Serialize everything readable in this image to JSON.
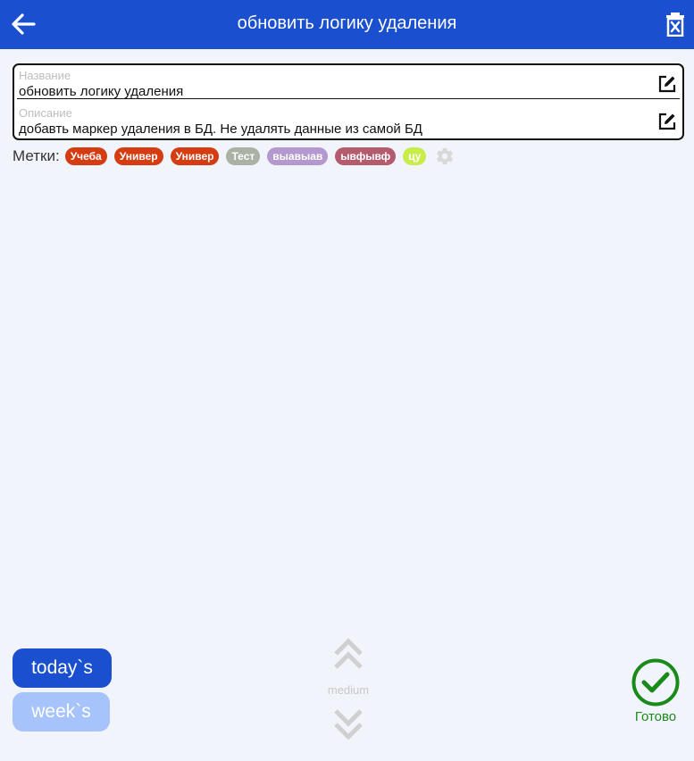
{
  "header": {
    "title": "обновить логику удаления",
    "back_icon": "arrow-left-icon",
    "delete_icon": "trash-x-icon",
    "bg_color": "#1a4fd0"
  },
  "task": {
    "name_label": "Название",
    "name_value": "обновить логику удаления",
    "desc_label": "Описание",
    "desc_value": "добавть маркер удаления в БД. Не удалять данные из самой БД"
  },
  "tags": {
    "label": "Метки:",
    "items": [
      {
        "text": "Учеба",
        "color": "#d53c12"
      },
      {
        "text": "Универ",
        "color": "#d53c12"
      },
      {
        "text": "Универ",
        "color": "#d53c12"
      },
      {
        "text": "Тест",
        "color": "#aab2a6"
      },
      {
        "text": "выавыав",
        "color": "#b399cf"
      },
      {
        "text": "ывфывф",
        "color": "#b45c6e"
      },
      {
        "text": "цу",
        "color": "#c8ec4a"
      }
    ]
  },
  "filters": {
    "today": "today`s",
    "week": "week`s"
  },
  "priority": {
    "label": "medium"
  },
  "done": {
    "label": "Готово",
    "color": "#1a8a1a"
  }
}
